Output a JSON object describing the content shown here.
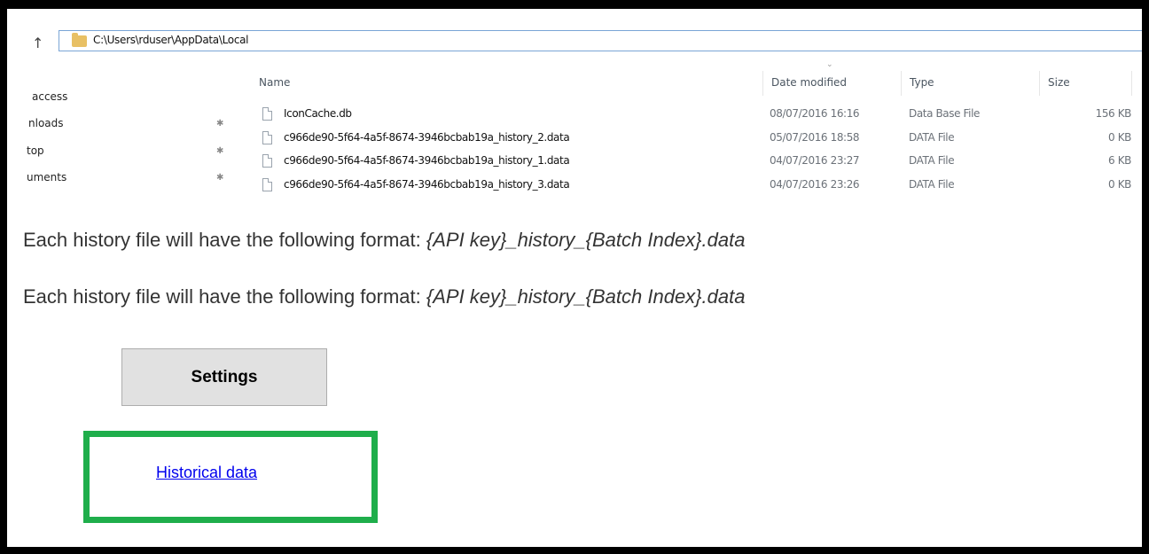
{
  "explorer": {
    "address_path": "C:\\Users\\rduser\\AppData\\Local",
    "nav_items": [
      {
        "label": "access",
        "pinned": false
      },
      {
        "label": "nloads",
        "pinned": true
      },
      {
        "label": "top",
        "pinned": true
      },
      {
        "label": "uments",
        "pinned": true
      }
    ],
    "columns": {
      "name": "Name",
      "date_modified": "Date modified",
      "type": "Type",
      "size": "Size"
    },
    "files": [
      {
        "name": "IconCache.db",
        "date": "08/07/2016 16:16",
        "type": "Data Base File",
        "size": "156 KB"
      },
      {
        "name": "c966de90-5f64-4a5f-8674-3946bcbab19a_history_2.data",
        "date": "05/07/2016 18:58",
        "type": "DATA File",
        "size": "0 KB"
      },
      {
        "name": "c966de90-5f64-4a5f-8674-3946bcbab19a_history_1.data",
        "date": "04/07/2016 23:27",
        "type": "DATA File",
        "size": "6 KB"
      },
      {
        "name": "c966de90-5f64-4a5f-8674-3946bcbab19a_history_3.data",
        "date": "04/07/2016 23:26",
        "type": "DATA File",
        "size": "0 KB"
      }
    ]
  },
  "document": {
    "line1_prefix": "Each history file will have the following format: ",
    "line1_format": "{API key}_history_{Batch Index}.data",
    "line2_prefix": "Each history file will have the following format: ",
    "line2_format": "{API key}_history_{Batch Index}.data"
  },
  "settings_button": {
    "label": "Settings"
  },
  "historical_link": {
    "label": "Historical data"
  },
  "colors": {
    "highlight_border": "#1fae4b",
    "link": "#0000ee",
    "button_bg": "#e1e1e1",
    "address_border": "#7aa5d6"
  }
}
